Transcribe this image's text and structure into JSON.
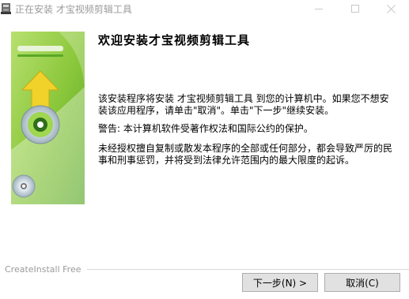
{
  "window": {
    "title": "正在安装 才宝视频剪辑工具"
  },
  "main": {
    "heading": "欢迎安装才宝视频剪辑工具",
    "paragraphs": [
      "该安装程序将安装 才宝视频剪辑工具 到您的计算机中。如果您不想安装该应用程序，请单击\"取消\"。单击\"下一步\"继续安装。",
      "警告: 本计算机软件受著作权法和国际公约的保护。",
      "未经授权擅自复制或散发本程序的全部或任何部分，都会导致严厉的民事和刑事惩罚，并将受到法律允许范围内的最大限度的起诉。"
    ]
  },
  "footer": {
    "brand": "CreateInstall Free",
    "next_label": "下一步(N) >",
    "cancel_label": "取消(C)"
  },
  "colors": {
    "banner_green": "#8cc83c",
    "banner_dark_green": "#4a9a1e",
    "arrow_yellow": "#f0d22a"
  }
}
